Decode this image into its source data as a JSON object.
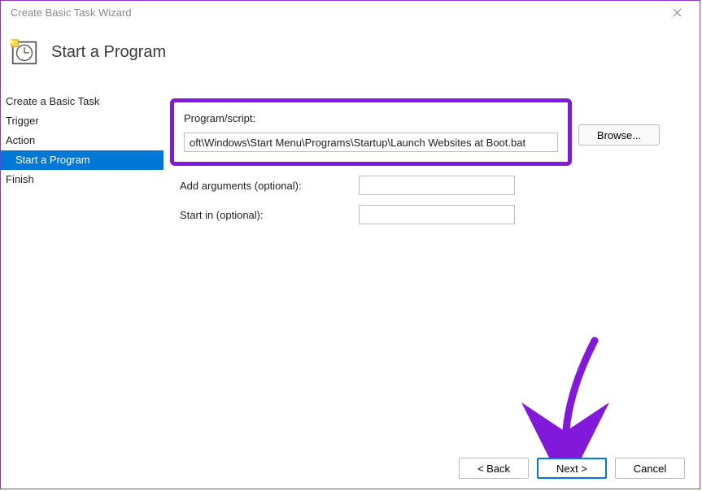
{
  "titlebar": {
    "title": "Create Basic Task Wizard"
  },
  "header": {
    "page_title": "Start a Program"
  },
  "sidebar": {
    "items": [
      {
        "label": "Create a Basic Task",
        "selected": false,
        "indent": false
      },
      {
        "label": "Trigger",
        "selected": false,
        "indent": false
      },
      {
        "label": "Action",
        "selected": false,
        "indent": false
      },
      {
        "label": "Start a Program",
        "selected": true,
        "indent": true
      },
      {
        "label": "Finish",
        "selected": false,
        "indent": false
      }
    ]
  },
  "main": {
    "program_label": "Program/script:",
    "program_value": "oft\\Windows\\Start Menu\\Programs\\Startup\\Launch Websites at Boot.bat",
    "browse_label": "Browse...",
    "arguments_label": "Add arguments (optional):",
    "arguments_value": "",
    "startin_label": "Start in (optional):",
    "startin_value": ""
  },
  "buttons": {
    "back": "< Back",
    "next": "Next >",
    "cancel": "Cancel"
  },
  "annotation": {
    "highlight_color": "#8219da",
    "arrow_color": "#8219da"
  }
}
